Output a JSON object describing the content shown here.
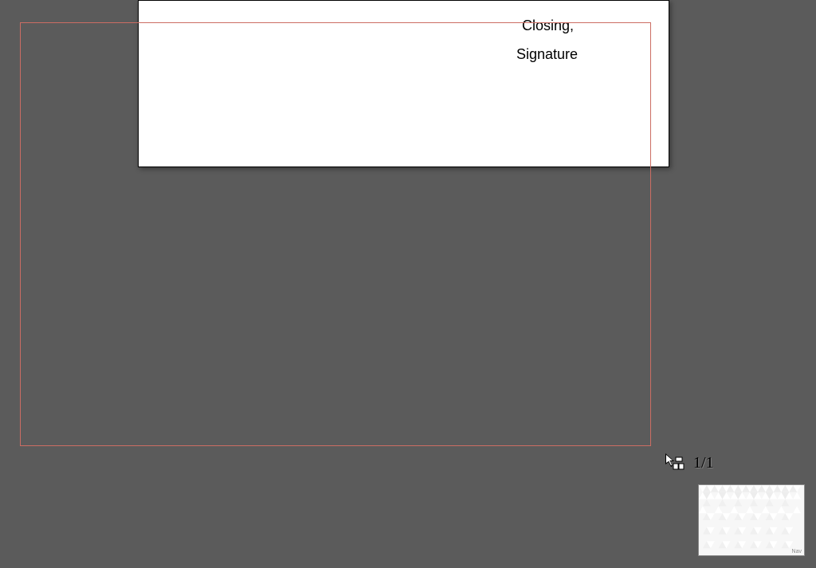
{
  "document": {
    "closing_text": "Closing,",
    "signature_text": "Signature"
  },
  "page_indicator": {
    "current": "1",
    "separator": "/",
    "total": "1"
  },
  "navigator": {
    "label": "Nav"
  }
}
